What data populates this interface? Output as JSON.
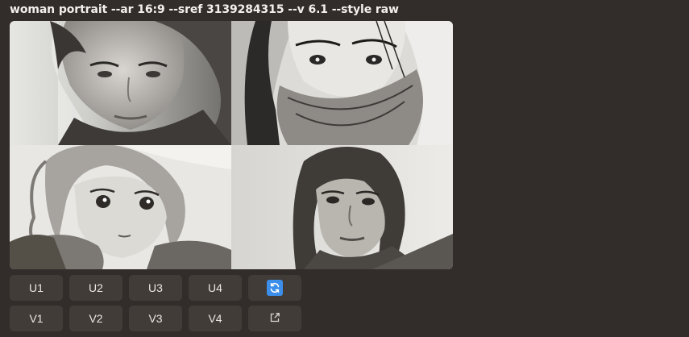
{
  "prompt_text": "woman portrait --ar 16:9 --sref 3139284315 --v 6.1 --style raw",
  "images": [
    {
      "name": "image-1"
    },
    {
      "name": "image-2"
    },
    {
      "name": "image-3"
    },
    {
      "name": "image-4"
    }
  ],
  "buttons": {
    "upscale": [
      "U1",
      "U2",
      "U3",
      "U4"
    ],
    "variation": [
      "V1",
      "V2",
      "V3",
      "V4"
    ],
    "reroll_icon": "refresh-icon",
    "web_icon": "external-link-icon"
  },
  "colors": {
    "background": "#322d2a",
    "button": "#423c38",
    "reroll_accent": "#3b8eea"
  }
}
